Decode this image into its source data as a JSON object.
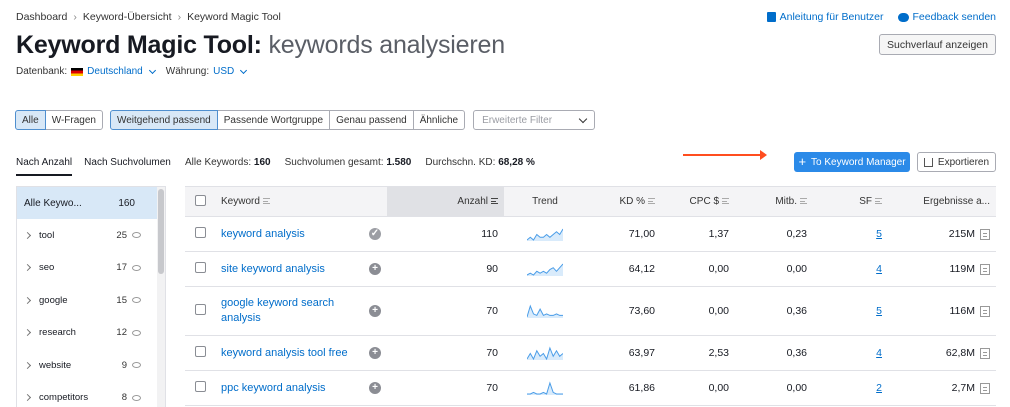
{
  "breadcrumb": [
    "Dashboard",
    "Keyword-Übersicht",
    "Keyword Magic Tool"
  ],
  "toplinks": {
    "manual": "Anleitung für Benutzer",
    "feedback": "Feedback senden"
  },
  "title": {
    "main": "Keyword Magic Tool:",
    "sub": "keywords analysieren"
  },
  "history_button": "Suchverlauf anzeigen",
  "database": {
    "label": "Datenbank:",
    "value": "Deutschland",
    "currency_label": "Währung:",
    "currency": "USD"
  },
  "filters": {
    "group1": [
      "Alle",
      "W-Fragen"
    ],
    "group2": [
      "Weitgehend passend",
      "Passende Wortgruppe",
      "Genau passend",
      "Ähnliche"
    ],
    "advanced_placeholder": "Erweiterte Filter"
  },
  "sort_tabs": [
    "Nach Anzahl",
    "Nach Suchvolumen"
  ],
  "summary": {
    "all_label": "Alle Keywords:",
    "all_value": "160",
    "volume_label": "Suchvolumen gesamt:",
    "volume_value": "1.580",
    "kd_label": "Durchschn. KD:",
    "kd_value": "68,28 %"
  },
  "actions": {
    "keyword_manager": "To Keyword Manager",
    "export": "Exportieren"
  },
  "sidebar": {
    "all_label": "Alle Keywo...",
    "all_count": "160",
    "items": [
      {
        "name": "tool",
        "count": "25"
      },
      {
        "name": "seo",
        "count": "17"
      },
      {
        "name": "google",
        "count": "15"
      },
      {
        "name": "research",
        "count": "12"
      },
      {
        "name": "website",
        "count": "9"
      },
      {
        "name": "competitors",
        "count": "8"
      }
    ]
  },
  "table": {
    "columns": {
      "keyword": "Keyword",
      "anzahl": "Anzahl",
      "trend": "Trend",
      "kd": "KD %",
      "cpc": "CPC $",
      "mitb": "Mitb.",
      "sf": "SF",
      "results": "Ergebnisse a..."
    },
    "rows": [
      {
        "keyword": "keyword analysis",
        "added": true,
        "anzahl": "110",
        "trend": [
          4,
          5,
          4,
          6,
          5,
          5,
          6,
          5,
          6,
          7,
          6,
          8
        ],
        "kd": "71,00",
        "cpc": "1,37",
        "mitb": "0,23",
        "sf": "5",
        "results": "215M"
      },
      {
        "keyword": "site keyword analysis",
        "added": false,
        "anzahl": "90",
        "trend": [
          2,
          3,
          2,
          4,
          3,
          4,
          3,
          5,
          6,
          4,
          6,
          8
        ],
        "kd": "64,12",
        "cpc": "0,00",
        "mitb": "0,00",
        "sf": "4",
        "results": "119M"
      },
      {
        "keyword": "google keyword search analysis",
        "added": false,
        "anzahl": "70",
        "trend": [
          2,
          9,
          4,
          3,
          7,
          3,
          4,
          3,
          3,
          4,
          3,
          3
        ],
        "kd": "73,60",
        "cpc": "0,00",
        "mitb": "0,36",
        "sf": "5",
        "results": "116M"
      },
      {
        "keyword": "keyword analysis tool free",
        "added": false,
        "anzahl": "70",
        "trend": [
          3,
          5,
          3,
          6,
          4,
          5,
          3,
          7,
          4,
          6,
          4,
          5
        ],
        "kd": "63,97",
        "cpc": "2,53",
        "mitb": "0,36",
        "sf": "4",
        "results": "62,8M"
      },
      {
        "keyword": "ppc keyword analysis",
        "added": false,
        "anzahl": "70",
        "trend": [
          1,
          1,
          2,
          1,
          1,
          2,
          1,
          8,
          2,
          1,
          1,
          1
        ],
        "kd": "61,86",
        "cpc": "0,00",
        "mitb": "0,00",
        "sf": "2",
        "results": "2,7M"
      }
    ]
  },
  "colors": {
    "link": "#006dca",
    "primary_button": "#2b8ae8",
    "arrow": "#ff4d1f",
    "selected": "#d8e8f7"
  }
}
